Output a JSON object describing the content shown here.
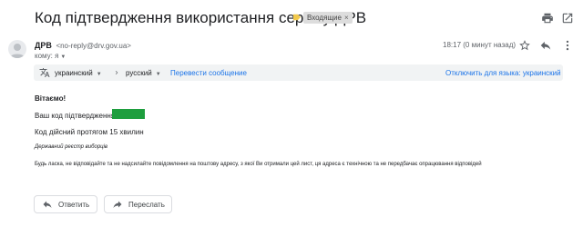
{
  "subject": "Код підтвердження використання сервісу ДРВ",
  "label": {
    "name": "Входящие",
    "remove": "×"
  },
  "icons": {
    "print": "print-icon",
    "open_new": "open-in-new-window-icon",
    "star": "star-icon",
    "reply": "reply-icon",
    "more": "more-vert-icon",
    "avatar": "avatar-icon",
    "translate": "translate-icon",
    "arrow": "chevron-right-icon",
    "label_tag": "label-tag-icon"
  },
  "sender": {
    "name": "ДРВ",
    "email": "<no-reply@drv.gov.ua>",
    "to": "кому: я",
    "time": "18:17 (0 минут назад)"
  },
  "translate": {
    "from_lang": "украинский",
    "to_lang": "русский",
    "translate_link": "Перевести сообщение",
    "disable_link": "Отключить для языка: украинский"
  },
  "body": {
    "greeting": "Вітаємо!",
    "code_label": "Ваш код підтвердження:",
    "validity": "Код дійсний протягом 15 хвилин",
    "signature": "Державний реєстр виборців",
    "warning": "Будь ласка, не відповідайте та не надсилайте повідомлення на поштову адресу, з якої Ви отримали цей лист, ця адреса є технічною та не передбачає опрацювання відповідей"
  },
  "actions": {
    "reply": "Ответить",
    "forward": "Переслать"
  },
  "colors": {
    "code_highlight": "#1e9e3e",
    "link": "#1a73e8",
    "label_icon": "#f2c94c"
  }
}
